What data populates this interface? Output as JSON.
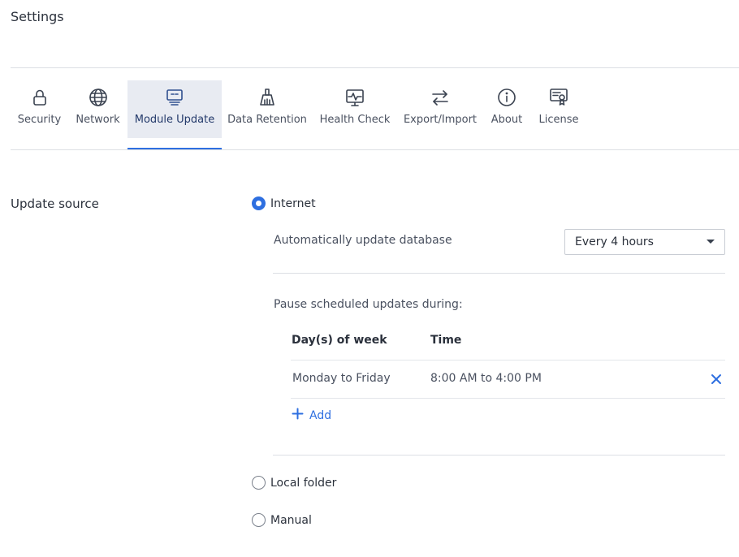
{
  "page": {
    "title": "Settings"
  },
  "tabs": [
    {
      "label": "Security",
      "icon": "lock-icon"
    },
    {
      "label": "Network",
      "icon": "globe-icon"
    },
    {
      "label": "Module Update",
      "icon": "module-update-icon",
      "active": true
    },
    {
      "label": "Data Retention",
      "icon": "broom-icon"
    },
    {
      "label": "Health Check",
      "icon": "health-monitor-icon"
    },
    {
      "label": "Export/Import",
      "icon": "swap-arrows-icon"
    },
    {
      "label": "About",
      "icon": "info-icon"
    },
    {
      "label": "License",
      "icon": "certificate-icon"
    }
  ],
  "update_source": {
    "label": "Update source",
    "options": {
      "internet": {
        "label": "Internet",
        "checked": true
      },
      "local_folder": {
        "label": "Local folder",
        "checked": false
      },
      "manual": {
        "label": "Manual",
        "checked": false
      }
    },
    "auto_update": {
      "label": "Automatically update database",
      "selected": "Every 4 hours"
    },
    "pause": {
      "label": "Pause scheduled updates during:",
      "columns": {
        "days": "Day(s) of week",
        "time": "Time"
      },
      "rows": [
        {
          "days": "Monday to Friday",
          "time": "8:00 AM to 4:00 PM"
        }
      ],
      "add_label": "Add"
    }
  },
  "colors": {
    "accent": "#2e6fe0",
    "active_tab_bg": "#e8ebf2",
    "text": "#2b313c"
  }
}
